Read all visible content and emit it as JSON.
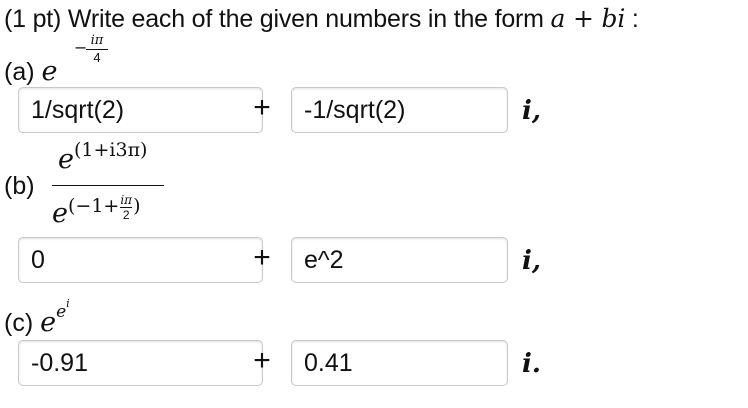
{
  "header": {
    "prefix": "(1 pt) Write each of the given numbers in the form ",
    "a": "a",
    "plus": " + ",
    "bi": "bi",
    "suffix": " :"
  },
  "parts": [
    {
      "label": "(a)",
      "expr": {
        "base": "e",
        "exp_sign": "−",
        "exp_num": "iπ",
        "exp_den": "4"
      },
      "real_value": "1/sqrt(2)",
      "imag_value": "-1/sqrt(2)",
      "i_suffix": "i,"
    },
    {
      "label": "(b)",
      "expr": {
        "num_base": "e",
        "num_exp": "(1+i3π)",
        "den_base": "e",
        "den_exp_open": "(−1+",
        "den_exp_frac_num": "iπ",
        "den_exp_frac_den": "2",
        "den_exp_close": ")"
      },
      "real_value": "0",
      "imag_value": "e^2",
      "i_suffix": "i,"
    },
    {
      "label": "(c)",
      "expr": {
        "base": "e",
        "exp1": "e",
        "exp2": "i"
      },
      "real_value": "-0.91",
      "imag_value": "0.41",
      "i_suffix": "i."
    }
  ],
  "plus_sign": "+"
}
